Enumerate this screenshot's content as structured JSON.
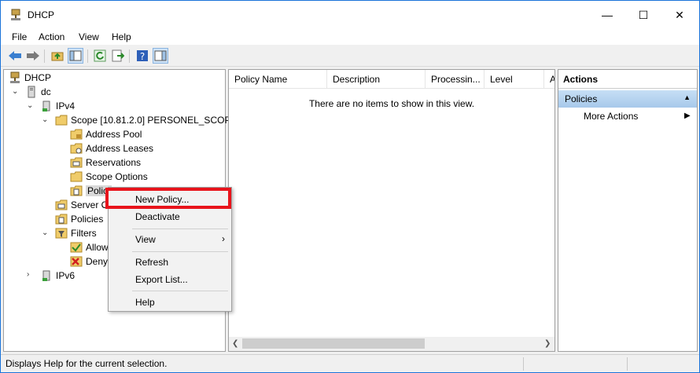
{
  "window": {
    "title": "DHCP",
    "minimize": "—",
    "maximize": "☐",
    "close": "✕"
  },
  "menu": [
    "File",
    "Action",
    "View",
    "Help"
  ],
  "tree": {
    "root": "DHCP",
    "server": "dc",
    "ipv4": "IPv4",
    "scope": "Scope [10.81.2.0] PERSONEL_SCOPE",
    "address_pool": "Address Pool",
    "address_leases": "Address Leases",
    "reservations": "Reservations",
    "scope_options": "Scope Options",
    "policies_scope": "Polici",
    "server_options": "Server Op",
    "policies": "Policies",
    "filters": "Filters",
    "allow": "Allow",
    "deny": "Deny",
    "ipv6": "IPv6"
  },
  "list": {
    "columns": [
      "Policy Name",
      "Description",
      "Processin...",
      "Level",
      "A"
    ],
    "empty_message": "There are no items to show in this view."
  },
  "actions": {
    "header": "Actions",
    "section": "Policies",
    "more_actions": "More Actions"
  },
  "context_menu": {
    "new_policy": "New Policy...",
    "deactivate": "Deactivate",
    "view": "View",
    "refresh": "Refresh",
    "export_list": "Export List...",
    "help": "Help"
  },
  "status": {
    "text": "Displays Help for the current selection."
  },
  "colors": {
    "highlight": "#e8141c",
    "section_bg": "#b9d6f2",
    "window_border": "#1a73d9"
  }
}
